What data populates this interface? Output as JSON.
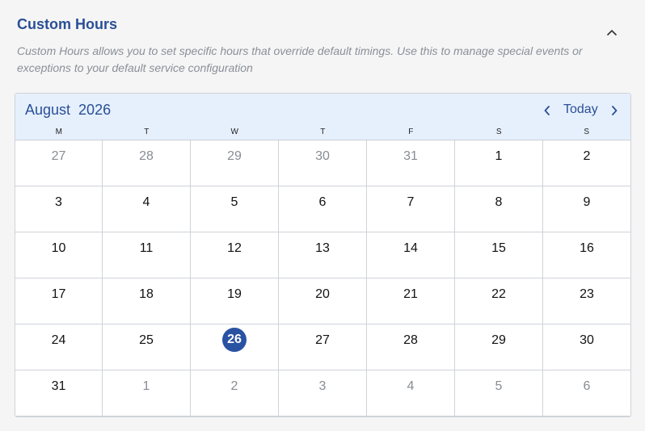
{
  "section": {
    "title": "Custom Hours",
    "description": "Custom Hours allows you to set specific hours that override default timings. Use this to manage special events or exceptions to your default service configuration"
  },
  "calendar": {
    "month_label": "August  2026",
    "today_label": "Today",
    "weekdays": [
      "M",
      "T",
      "W",
      "T",
      "F",
      "S",
      "S"
    ],
    "weeks": [
      [
        {
          "d": "27",
          "m": true
        },
        {
          "d": "28",
          "m": true
        },
        {
          "d": "29",
          "m": true
        },
        {
          "d": "30",
          "m": true
        },
        {
          "d": "31",
          "m": true
        },
        {
          "d": "1"
        },
        {
          "d": "2"
        }
      ],
      [
        {
          "d": "3"
        },
        {
          "d": "4"
        },
        {
          "d": "5"
        },
        {
          "d": "6"
        },
        {
          "d": "7"
        },
        {
          "d": "8"
        },
        {
          "d": "9"
        }
      ],
      [
        {
          "d": "10"
        },
        {
          "d": "11"
        },
        {
          "d": "12"
        },
        {
          "d": "13"
        },
        {
          "d": "14"
        },
        {
          "d": "15"
        },
        {
          "d": "16"
        }
      ],
      [
        {
          "d": "17"
        },
        {
          "d": "18"
        },
        {
          "d": "19"
        },
        {
          "d": "20"
        },
        {
          "d": "21"
        },
        {
          "d": "22"
        },
        {
          "d": "23"
        }
      ],
      [
        {
          "d": "24"
        },
        {
          "d": "25"
        },
        {
          "d": "26",
          "today": true
        },
        {
          "d": "27"
        },
        {
          "d": "28"
        },
        {
          "d": "29"
        },
        {
          "d": "30"
        }
      ],
      [
        {
          "d": "31"
        },
        {
          "d": "1",
          "m": true
        },
        {
          "d": "2",
          "m": true
        },
        {
          "d": "3",
          "m": true
        },
        {
          "d": "4",
          "m": true
        },
        {
          "d": "5",
          "m": true
        },
        {
          "d": "6",
          "m": true
        }
      ]
    ]
  },
  "icons": {
    "collapse": "chevron-up-icon",
    "prev": "chevron-left-icon",
    "next": "chevron-right-icon"
  },
  "colors": {
    "accent": "#2a4f97",
    "header_bg": "#e6f0fd",
    "today_bg": "#2a52a3",
    "muted_text": "#888c93"
  }
}
